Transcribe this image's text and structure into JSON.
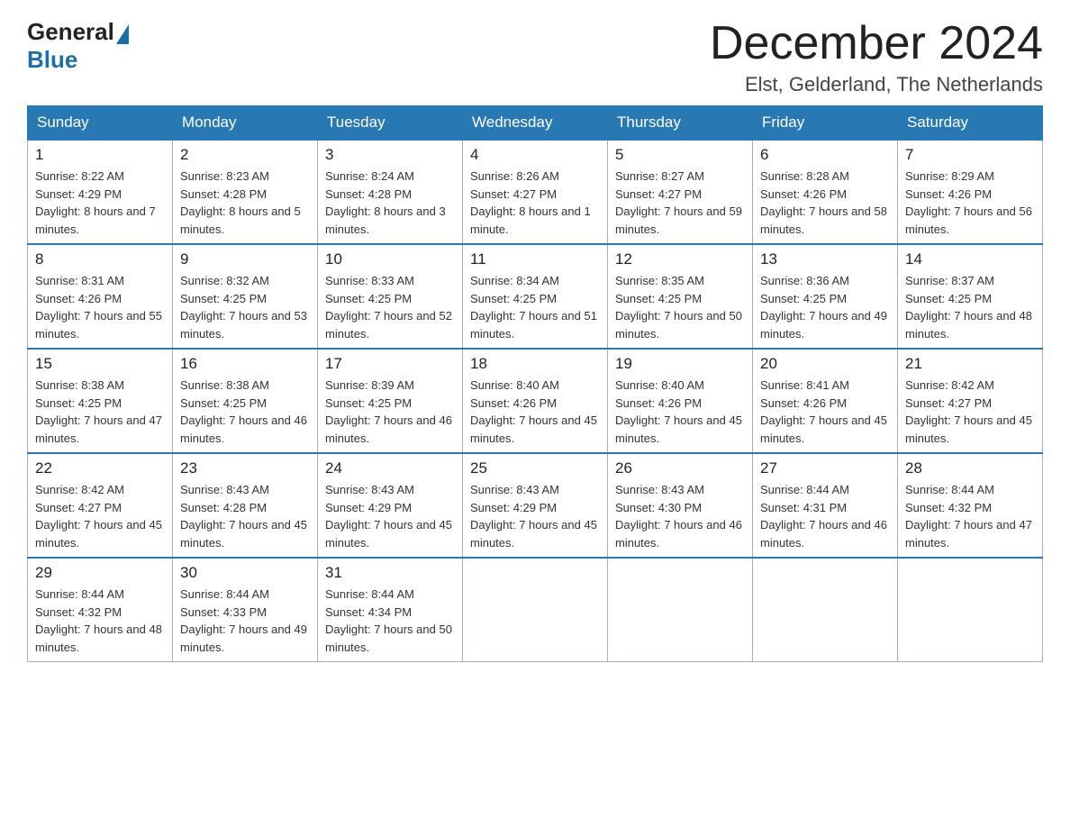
{
  "header": {
    "logo_general": "General",
    "logo_blue": "Blue",
    "month_title": "December 2024",
    "location": "Elst, Gelderland, The Netherlands"
  },
  "weekdays": [
    "Sunday",
    "Monday",
    "Tuesday",
    "Wednesday",
    "Thursday",
    "Friday",
    "Saturday"
  ],
  "weeks": [
    [
      {
        "day": "1",
        "sunrise": "8:22 AM",
        "sunset": "4:29 PM",
        "daylight": "8 hours and 7 minutes."
      },
      {
        "day": "2",
        "sunrise": "8:23 AM",
        "sunset": "4:28 PM",
        "daylight": "8 hours and 5 minutes."
      },
      {
        "day": "3",
        "sunrise": "8:24 AM",
        "sunset": "4:28 PM",
        "daylight": "8 hours and 3 minutes."
      },
      {
        "day": "4",
        "sunrise": "8:26 AM",
        "sunset": "4:27 PM",
        "daylight": "8 hours and 1 minute."
      },
      {
        "day": "5",
        "sunrise": "8:27 AM",
        "sunset": "4:27 PM",
        "daylight": "7 hours and 59 minutes."
      },
      {
        "day": "6",
        "sunrise": "8:28 AM",
        "sunset": "4:26 PM",
        "daylight": "7 hours and 58 minutes."
      },
      {
        "day": "7",
        "sunrise": "8:29 AM",
        "sunset": "4:26 PM",
        "daylight": "7 hours and 56 minutes."
      }
    ],
    [
      {
        "day": "8",
        "sunrise": "8:31 AM",
        "sunset": "4:26 PM",
        "daylight": "7 hours and 55 minutes."
      },
      {
        "day": "9",
        "sunrise": "8:32 AM",
        "sunset": "4:25 PM",
        "daylight": "7 hours and 53 minutes."
      },
      {
        "day": "10",
        "sunrise": "8:33 AM",
        "sunset": "4:25 PM",
        "daylight": "7 hours and 52 minutes."
      },
      {
        "day": "11",
        "sunrise": "8:34 AM",
        "sunset": "4:25 PM",
        "daylight": "7 hours and 51 minutes."
      },
      {
        "day": "12",
        "sunrise": "8:35 AM",
        "sunset": "4:25 PM",
        "daylight": "7 hours and 50 minutes."
      },
      {
        "day": "13",
        "sunrise": "8:36 AM",
        "sunset": "4:25 PM",
        "daylight": "7 hours and 49 minutes."
      },
      {
        "day": "14",
        "sunrise": "8:37 AM",
        "sunset": "4:25 PM",
        "daylight": "7 hours and 48 minutes."
      }
    ],
    [
      {
        "day": "15",
        "sunrise": "8:38 AM",
        "sunset": "4:25 PM",
        "daylight": "7 hours and 47 minutes."
      },
      {
        "day": "16",
        "sunrise": "8:38 AM",
        "sunset": "4:25 PM",
        "daylight": "7 hours and 46 minutes."
      },
      {
        "day": "17",
        "sunrise": "8:39 AM",
        "sunset": "4:25 PM",
        "daylight": "7 hours and 46 minutes."
      },
      {
        "day": "18",
        "sunrise": "8:40 AM",
        "sunset": "4:26 PM",
        "daylight": "7 hours and 45 minutes."
      },
      {
        "day": "19",
        "sunrise": "8:40 AM",
        "sunset": "4:26 PM",
        "daylight": "7 hours and 45 minutes."
      },
      {
        "day": "20",
        "sunrise": "8:41 AM",
        "sunset": "4:26 PM",
        "daylight": "7 hours and 45 minutes."
      },
      {
        "day": "21",
        "sunrise": "8:42 AM",
        "sunset": "4:27 PM",
        "daylight": "7 hours and 45 minutes."
      }
    ],
    [
      {
        "day": "22",
        "sunrise": "8:42 AM",
        "sunset": "4:27 PM",
        "daylight": "7 hours and 45 minutes."
      },
      {
        "day": "23",
        "sunrise": "8:43 AM",
        "sunset": "4:28 PM",
        "daylight": "7 hours and 45 minutes."
      },
      {
        "day": "24",
        "sunrise": "8:43 AM",
        "sunset": "4:29 PM",
        "daylight": "7 hours and 45 minutes."
      },
      {
        "day": "25",
        "sunrise": "8:43 AM",
        "sunset": "4:29 PM",
        "daylight": "7 hours and 45 minutes."
      },
      {
        "day": "26",
        "sunrise": "8:43 AM",
        "sunset": "4:30 PM",
        "daylight": "7 hours and 46 minutes."
      },
      {
        "day": "27",
        "sunrise": "8:44 AM",
        "sunset": "4:31 PM",
        "daylight": "7 hours and 46 minutes."
      },
      {
        "day": "28",
        "sunrise": "8:44 AM",
        "sunset": "4:32 PM",
        "daylight": "7 hours and 47 minutes."
      }
    ],
    [
      {
        "day": "29",
        "sunrise": "8:44 AM",
        "sunset": "4:32 PM",
        "daylight": "7 hours and 48 minutes."
      },
      {
        "day": "30",
        "sunrise": "8:44 AM",
        "sunset": "4:33 PM",
        "daylight": "7 hours and 49 minutes."
      },
      {
        "day": "31",
        "sunrise": "8:44 AM",
        "sunset": "4:34 PM",
        "daylight": "7 hours and 50 minutes."
      },
      null,
      null,
      null,
      null
    ]
  ]
}
